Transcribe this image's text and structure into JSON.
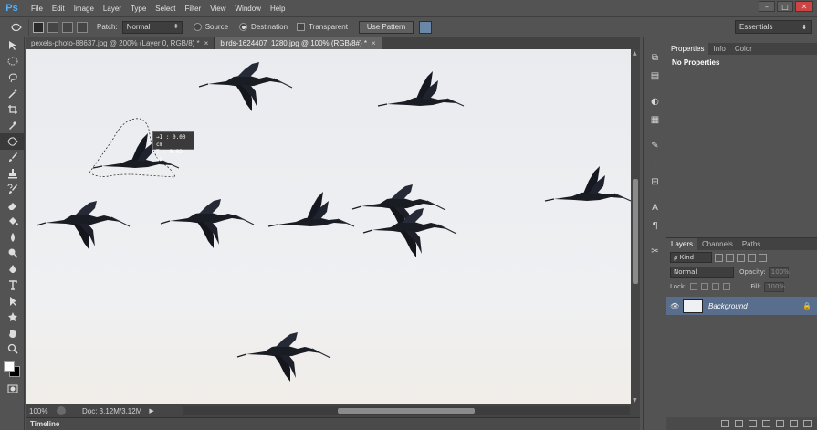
{
  "app": {
    "logo": "Ps"
  },
  "menu": [
    "File",
    "Edit",
    "Image",
    "Layer",
    "Type",
    "Select",
    "Filter",
    "View",
    "Window",
    "Help"
  ],
  "window_controls": {
    "minimize": "–",
    "maximize": "□",
    "close": "✕"
  },
  "options_bar": {
    "patch_label": "Patch:",
    "patch_value": "Normal",
    "source_label": "Source",
    "destination_label": "Destination",
    "transparent_label": "Transparent",
    "use_pattern_label": "Use Pattern",
    "workspace": "Essentials"
  },
  "tabs": [
    {
      "label": "pexels-photo-88637.jpg @ 200% (Layer 0, RGB/8) *",
      "close": "×"
    },
    {
      "label": "birds-1624407_1280.jpg @ 100% (RGB/8#) *",
      "close": "×"
    }
  ],
  "measure_tooltip": {
    "line1": "→I : 0.00 cm",
    "line2": "T : 0.02 cm"
  },
  "status": {
    "zoom": "100%",
    "doc": "Doc: 3.12M/3.12M",
    "arrow": "▶"
  },
  "timeline": {
    "label": "Timeline"
  },
  "properties_panel": {
    "tabs": [
      "Properties",
      "Info",
      "Color"
    ],
    "content": "No Properties"
  },
  "layers_panel": {
    "tabs": [
      "Layers",
      "Channels",
      "Paths"
    ],
    "kind_label": "ρ Kind",
    "blend_mode": "Normal",
    "opacity_label": "Opacity:",
    "opacity_value": "100%",
    "lock_label": "Lock:",
    "fill_label": "Fill:",
    "fill_value": "100%",
    "layers": [
      {
        "name": "Background",
        "visible": true,
        "locked": true
      }
    ]
  },
  "colors": {
    "accent": "#4fb0ff",
    "layer_selected": "#596e8c",
    "canvas": "#ebedf0"
  }
}
